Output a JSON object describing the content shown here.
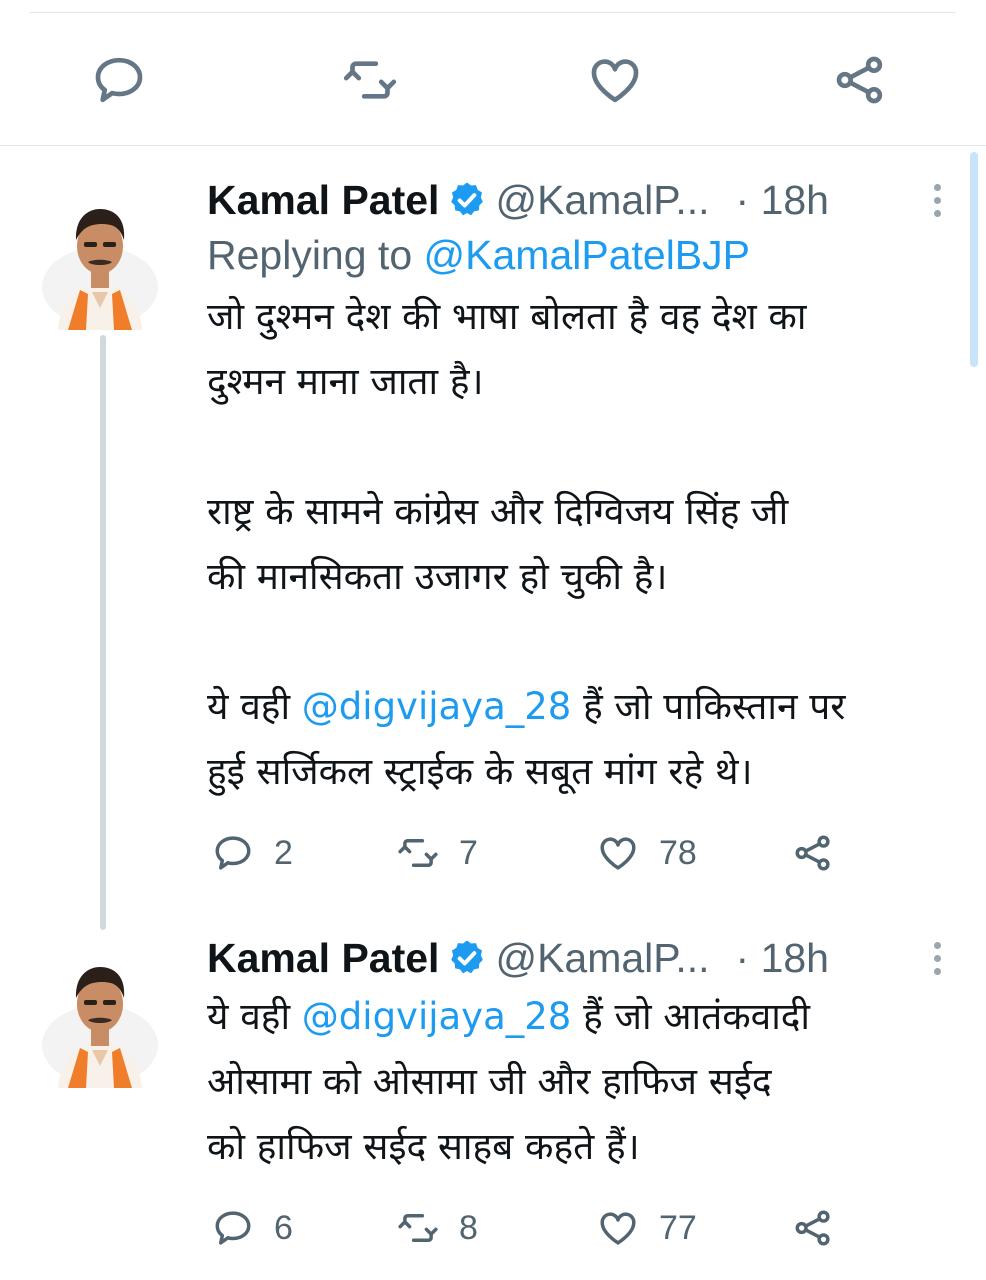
{
  "icons": {
    "reply": "speech-bubble",
    "retweet": "retweet-arrows",
    "like": "heart",
    "share": "share-nodes",
    "verified": "verified-badge",
    "more": "vertical-ellipsis"
  },
  "colors": {
    "link": "#1d9bf0",
    "muted": "#536471",
    "verified": "#1d9bf0"
  },
  "tweets": [
    {
      "name": "Kamal Patel",
      "handle": "@KamalP...",
      "time": "· 18h",
      "replying_prefix": "Replying to ",
      "replying_to": "@KamalPatelBJP",
      "lines": [
        "जो दुश्मन देश की भाषा बोलता है वह देश का",
        "दुश्मन माना जाता है।",
        "राष्ट्र के सामने कांग्रेस और दिग्विजय सिंह जी",
        "की मानसिकता उजागर हो चुकी है।",
        "ये वही ",
        "@digvijaya_28",
        " हैं जो पाकिस्तान पर",
        "हुई सर्जिकल स्ट्राईक के सबूत मांग रहे थे।"
      ],
      "replies": "2",
      "retweets": "7",
      "likes": "78"
    },
    {
      "name": "Kamal Patel",
      "handle": "@KamalP...",
      "time": "· 18h",
      "lines": [
        "ये वही ",
        "@digvijaya_28",
        " हैं जो आतंकवादी",
        "ओसामा को ओसामा जी और हाफिज सईद",
        "को हाफिज सईद साहब कहते हैं।"
      ],
      "replies": "6",
      "retweets": "8",
      "likes": "77"
    }
  ]
}
